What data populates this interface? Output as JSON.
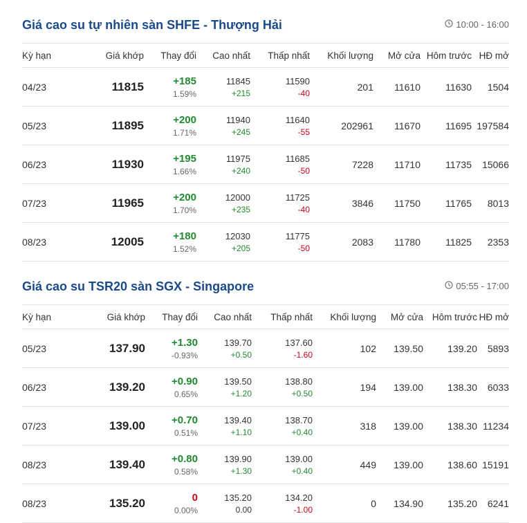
{
  "colors": {
    "title": "#1a4a8a",
    "up": "#1f8a2e",
    "down": "#d0021b",
    "neutral": "#333333"
  },
  "columns": [
    "Kỳ hạn",
    "Giá khớp",
    "Thay đổi",
    "Cao nhất",
    "Thấp nhất",
    "Khối lượng",
    "Mở cửa",
    "Hôm trước",
    "HĐ mở"
  ],
  "shfe": {
    "title": "Giá cao su tự nhiên sàn SHFE - Thượng Hải",
    "time": "10:00 - 16:00",
    "rows": [
      {
        "term": "04/23",
        "price": "11815",
        "change": "+185",
        "change_dir": "up",
        "pct": "1.59%",
        "high": "11845",
        "high_diff": "+215",
        "high_dir": "up",
        "low": "11590",
        "low_diff": "-40",
        "low_dir": "down",
        "volume": "201",
        "open": "11610",
        "prev": "11630",
        "oi": "1504"
      },
      {
        "term": "05/23",
        "price": "11895",
        "change": "+200",
        "change_dir": "up",
        "pct": "1.71%",
        "high": "11940",
        "high_diff": "+245",
        "high_dir": "up",
        "low": "11640",
        "low_diff": "-55",
        "low_dir": "down",
        "volume": "202961",
        "open": "11670",
        "prev": "11695",
        "oi": "197584"
      },
      {
        "term": "06/23",
        "price": "11930",
        "change": "+195",
        "change_dir": "up",
        "pct": "1.66%",
        "high": "11975",
        "high_diff": "+240",
        "high_dir": "up",
        "low": "11685",
        "low_diff": "-50",
        "low_dir": "down",
        "volume": "7228",
        "open": "11710",
        "prev": "11735",
        "oi": "15066"
      },
      {
        "term": "07/23",
        "price": "11965",
        "change": "+200",
        "change_dir": "up",
        "pct": "1.70%",
        "high": "12000",
        "high_diff": "+235",
        "high_dir": "up",
        "low": "11725",
        "low_diff": "-40",
        "low_dir": "down",
        "volume": "3846",
        "open": "11750",
        "prev": "11765",
        "oi": "8013"
      },
      {
        "term": "08/23",
        "price": "12005",
        "change": "+180",
        "change_dir": "up",
        "pct": "1.52%",
        "high": "12030",
        "high_diff": "+205",
        "high_dir": "up",
        "low": "11775",
        "low_diff": "-50",
        "low_dir": "down",
        "volume": "2083",
        "open": "11780",
        "prev": "11825",
        "oi": "2353"
      }
    ]
  },
  "sgx": {
    "title": "Giá cao su TSR20 sàn SGX - Singapore",
    "time": "05:55 - 17:00",
    "rows": [
      {
        "term": "05/23",
        "price": "137.90",
        "change": "+1.30",
        "change_dir": "up",
        "pct": "-0.93%",
        "high": "139.70",
        "high_diff": "+0.50",
        "high_dir": "up",
        "low": "137.60",
        "low_diff": "-1.60",
        "low_dir": "down",
        "volume": "102",
        "open": "139.50",
        "prev": "139.20",
        "oi": "5893"
      },
      {
        "term": "06/23",
        "price": "139.20",
        "change": "+0.90",
        "change_dir": "up",
        "pct": "0.65%",
        "high": "139.50",
        "high_diff": "+1.20",
        "high_dir": "up",
        "low": "138.80",
        "low_diff": "+0.50",
        "low_dir": "up",
        "volume": "194",
        "open": "139.00",
        "prev": "138.30",
        "oi": "6033"
      },
      {
        "term": "07/23",
        "price": "139.00",
        "change": "+0.70",
        "change_dir": "up",
        "pct": "0.51%",
        "high": "139.40",
        "high_diff": "+1.10",
        "high_dir": "up",
        "low": "138.70",
        "low_diff": "+0.40",
        "low_dir": "up",
        "volume": "318",
        "open": "139.00",
        "prev": "138.30",
        "oi": "11234"
      },
      {
        "term": "08/23",
        "price": "139.40",
        "change": "+0.80",
        "change_dir": "up",
        "pct": "0.58%",
        "high": "139.90",
        "high_diff": "+1.30",
        "high_dir": "up",
        "low": "139.00",
        "low_diff": "+0.40",
        "low_dir": "up",
        "volume": "449",
        "open": "139.00",
        "prev": "138.60",
        "oi": "15191"
      },
      {
        "term": "08/23",
        "price": "135.20",
        "change": "0",
        "change_dir": "zero",
        "pct": "0.00%",
        "high": "135.20",
        "high_diff": "0.00",
        "high_dir": "neutral",
        "low": "134.20",
        "low_diff": "-1.00",
        "low_dir": "down",
        "volume": "0",
        "open": "134.90",
        "prev": "135.20",
        "oi": "6241"
      }
    ]
  }
}
